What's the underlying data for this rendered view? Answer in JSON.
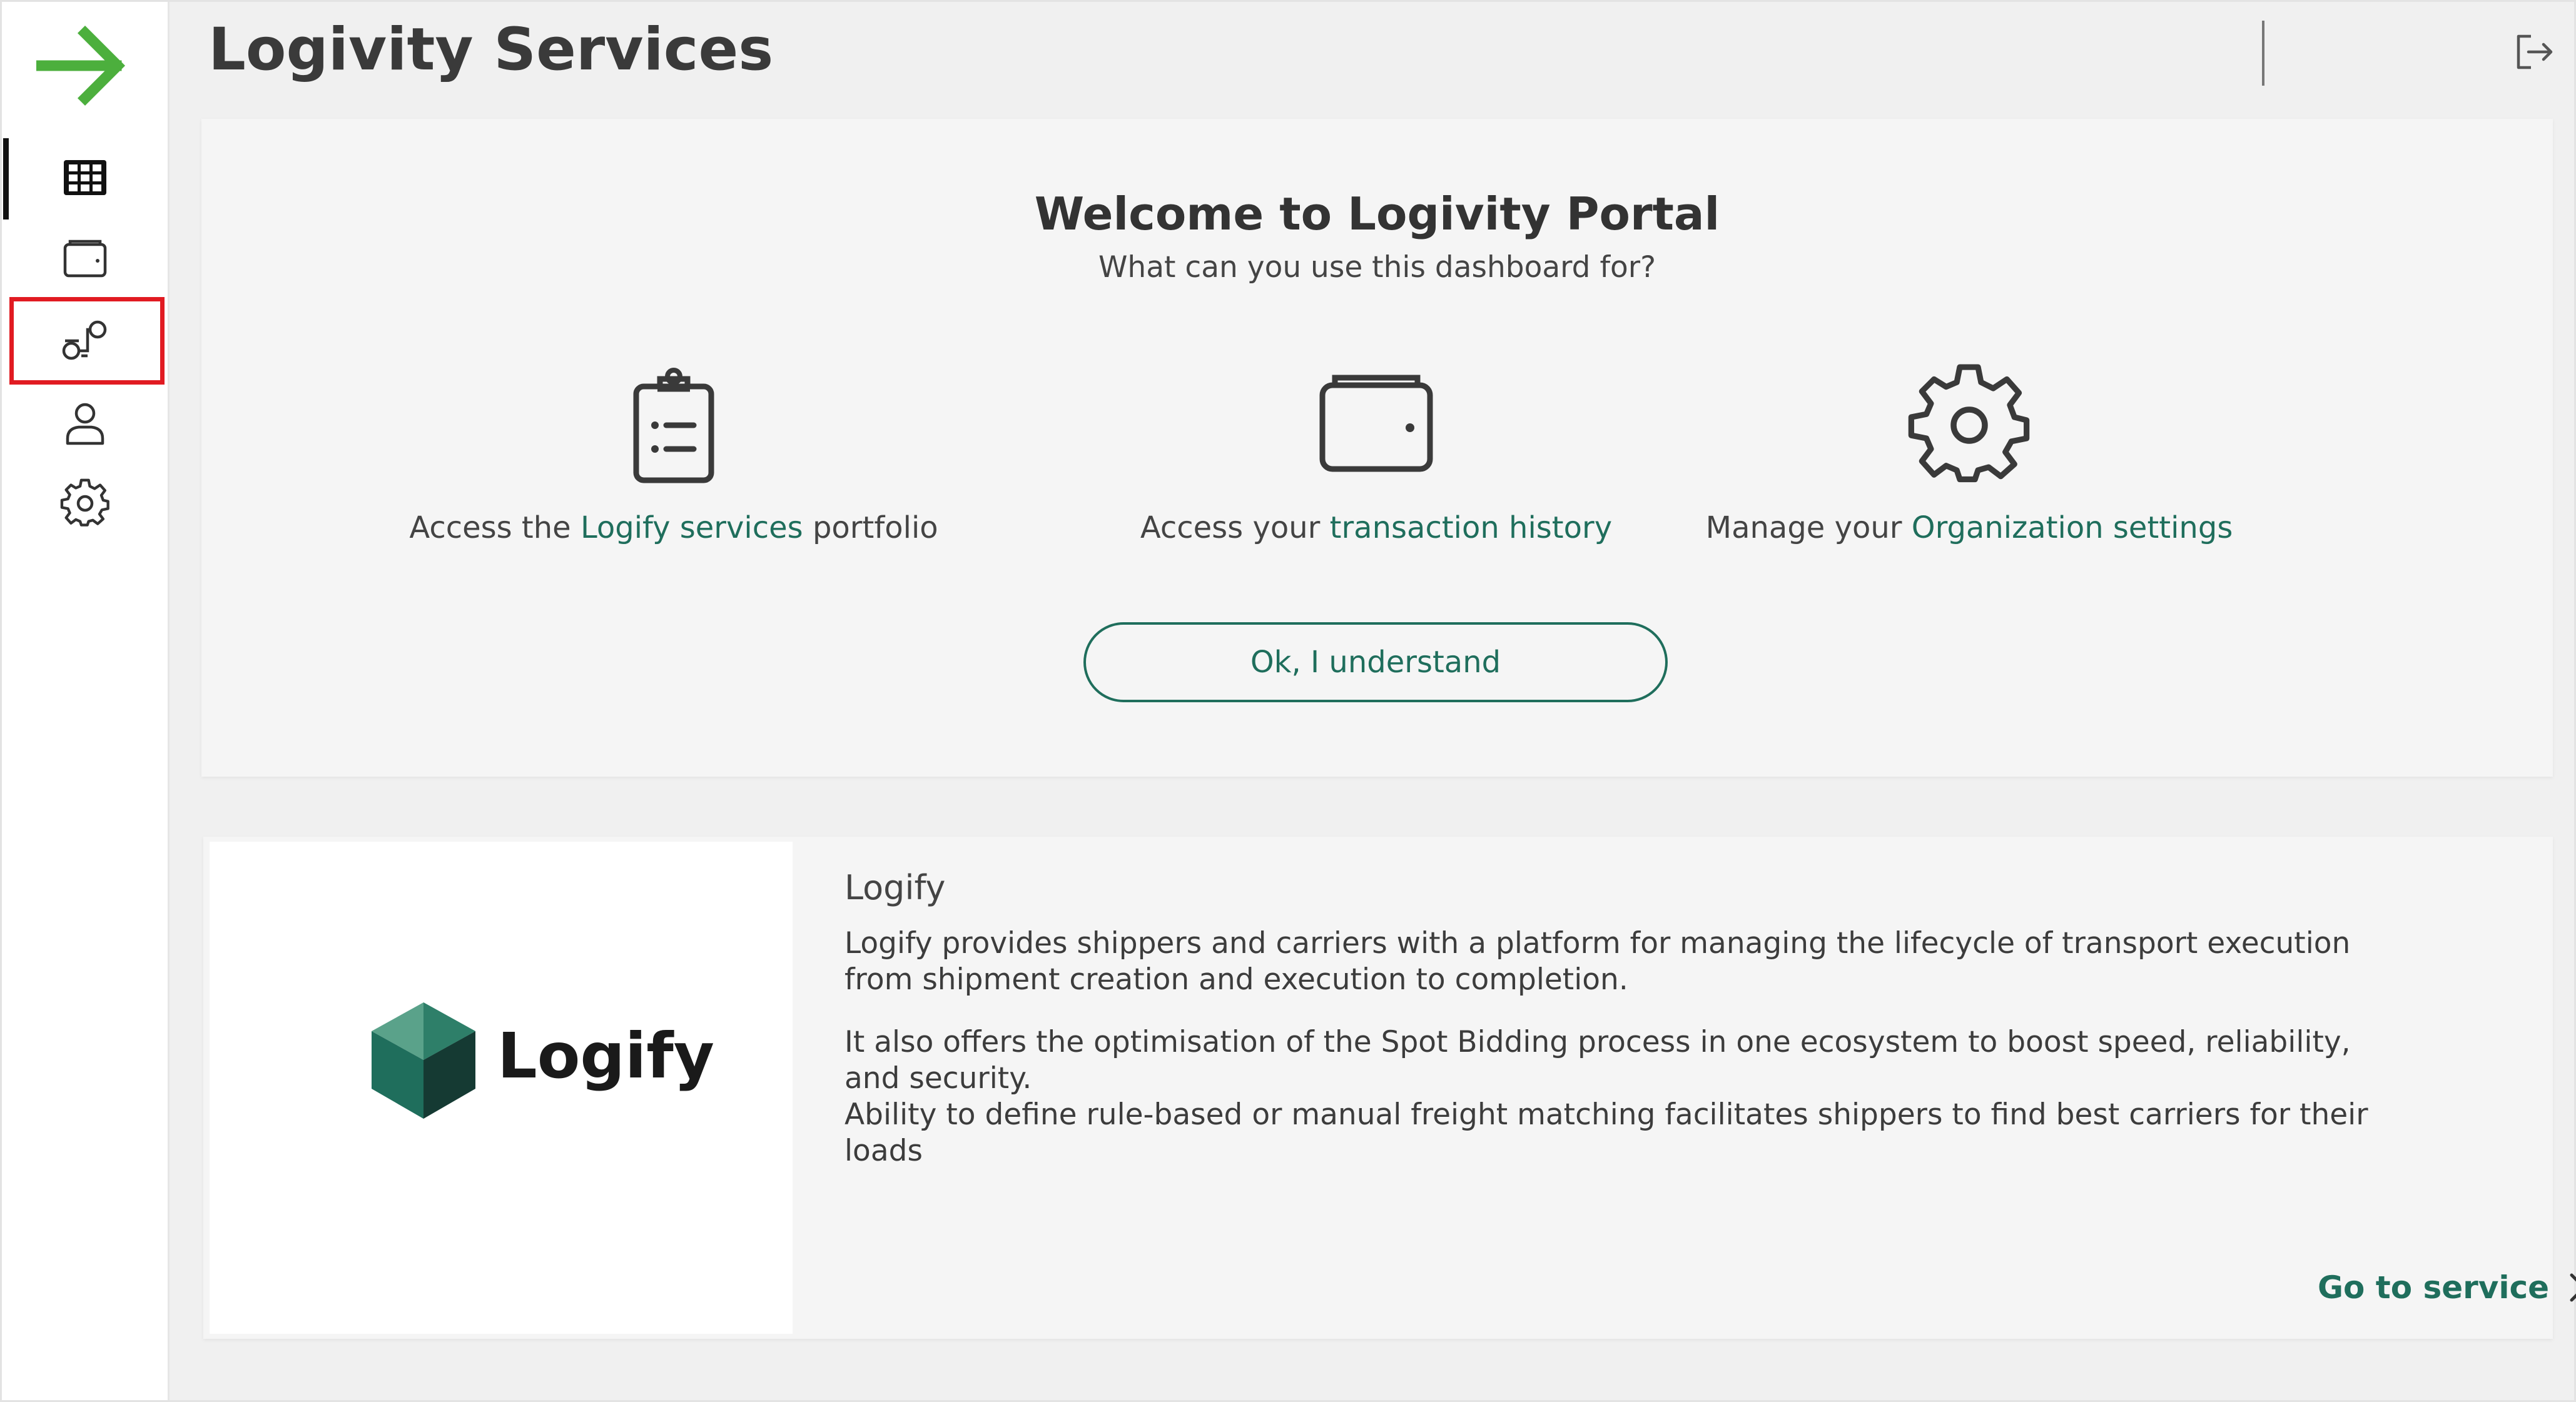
{
  "header": {
    "title": "Logivity Services"
  },
  "sidebar": {
    "items": [
      {
        "icon": "grid-icon",
        "active": true
      },
      {
        "icon": "wallet-icon",
        "active": false
      },
      {
        "icon": "services-icon",
        "active": false,
        "highlighted": true
      },
      {
        "icon": "user-icon",
        "active": false
      },
      {
        "icon": "gear-icon",
        "active": false
      }
    ],
    "highlight_color": "#e11b22"
  },
  "welcome": {
    "title": "Welcome to Logivity Portal",
    "subtitle": "What can you use this dashboard for?",
    "features": [
      {
        "icon": "clipboard-icon",
        "prefix": "Access the ",
        "link": "Logify services",
        "suffix": " portfolio"
      },
      {
        "icon": "wallet-icon",
        "prefix": "Access your ",
        "link": "transaction history",
        "suffix": ""
      },
      {
        "icon": "gear-icon",
        "prefix": "Manage your ",
        "link": "Organization settings",
        "suffix": ""
      }
    ],
    "button_label": "Ok, I understand"
  },
  "service": {
    "logo_text": "Logify",
    "name": "Logify",
    "description_1": "Logify provides shippers and carriers with a platform for managing the lifecycle of transport execution from shipment creation and execution to completion.",
    "description_2": "It also offers the optimisation of the Spot Bidding process in one ecosystem to boost speed, reliability, and security.",
    "description_3": "Ability to define rule-based or manual freight matching facilitates shippers to find best carriers for their loads",
    "cta_label": "Go to service"
  },
  "colors": {
    "accent": "#1f6e5c",
    "brand_green": "#4caf3d",
    "background": "#f0f0f0"
  }
}
